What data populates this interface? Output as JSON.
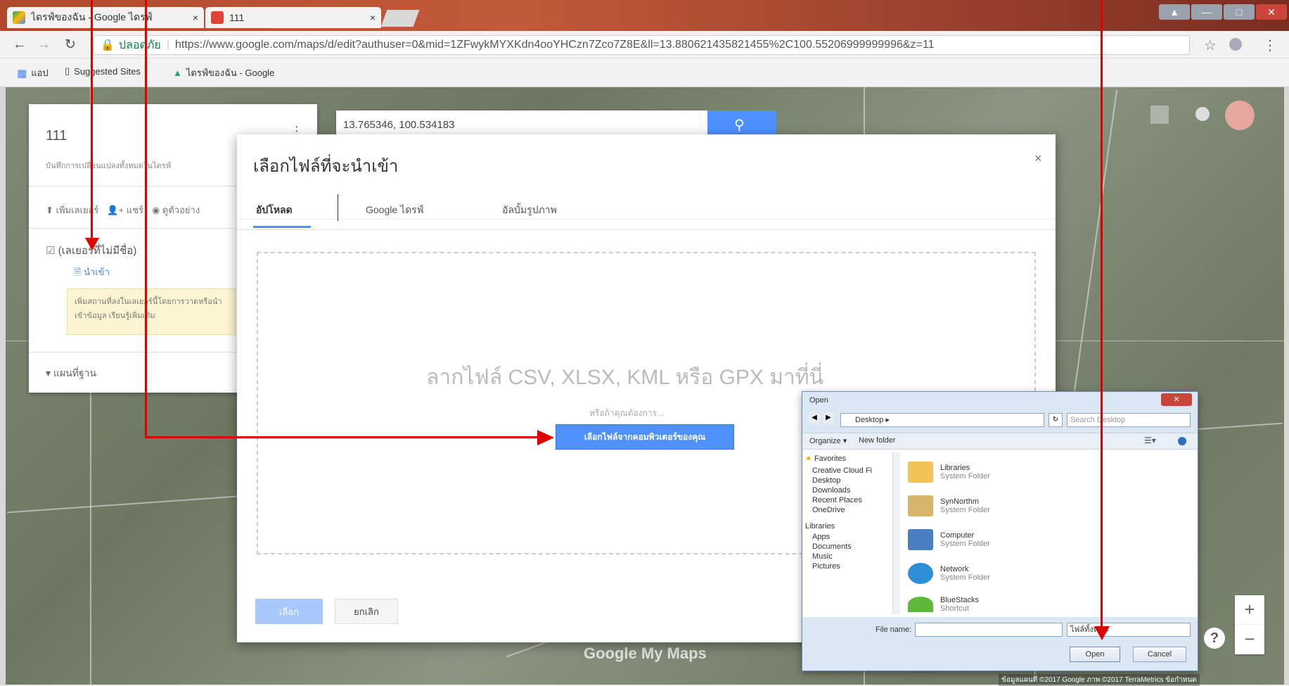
{
  "browser": {
    "tabs": [
      {
        "label": "ไดรฟ์ของฉัน - Google ไดรฟ์",
        "close": "×"
      },
      {
        "label": "111",
        "close": "×"
      }
    ],
    "url": "https://www.google.com/maps/d/edit?authuser=0&mid=1ZFwykMYXKdn4ooYHCzn7Zco7Z8E&ll=13.880621435821455%2C100.55206999999996&z=11",
    "secure_label": "ปลอดภัย",
    "bookmarks": [
      "แอป",
      "Suggested Sites",
      "ไดรฟ์ของฉัน - Google"
    ]
  },
  "panel": {
    "title": "111",
    "subtitle": "บันทึกการเปลี่ยนแปลงทั้งหมดในไดรฟ์",
    "actions": [
      "เพิ่มเลเยอร์",
      "แชร์",
      "ดูตัวอย่าง"
    ],
    "layer_name": "(เลเยอร์ที่ไม่มีชื่อ)",
    "import_link": "นำเข้า",
    "hint": "เพิ่มสถานที่ลงในเลเยอร์นี้โดยการวาดหรือนำเข้าข้อมูล เรียนรู้เพิ่มเติม",
    "basemap": "แผนที่ฐาน"
  },
  "search": {
    "value": "13.765346, 100.534183"
  },
  "dialog": {
    "title": "เลือกไฟล์ที่จะนำเข้า",
    "close": "×",
    "tabs": [
      "อัปโหลด",
      "Google ไดรฟ์",
      "อัลบั้มรูปภาพ"
    ],
    "drop_text": "ลากไฟล์ CSV, XLSX, KML หรือ GPX มาที่นี่",
    "or_text": "หรือถ้าคุณต้องการ...",
    "choose_button": "เลือกไฟล์จากคอมพิวเตอร์ของคุณ",
    "select_button": "เลือก",
    "cancel_button": "ยกเลิก"
  },
  "filedlg": {
    "title": "Open",
    "path": "Desktop ▸",
    "search_placeholder": "Search Desktop",
    "organize": "Organize ▾",
    "new_folder": "New folder",
    "nav": {
      "favorites": "Favorites",
      "items": [
        "Creative Cloud Fi",
        "Desktop",
        "Downloads",
        "Recent Places",
        "OneDrive"
      ],
      "libraries": "Libraries",
      "lib_items": [
        "Apps",
        "Documents",
        "Music",
        "Pictures"
      ]
    },
    "files": [
      {
        "name": "Libraries",
        "type": "System Folder"
      },
      {
        "name": "SynNorthm",
        "type": "System Folder"
      },
      {
        "name": "Computer",
        "type": "System Folder"
      },
      {
        "name": "Network",
        "type": "System Folder"
      },
      {
        "name": "BlueStacks",
        "type": "Shortcut"
      }
    ],
    "file_name_label": "File name:",
    "file_type": "ไฟล์ทั้งหมด",
    "open_button": "Open",
    "cancel_button": "Cancel"
  },
  "map": {
    "watermark": "Google My Maps",
    "attribution": "ข้อมูลแผนที่ ©2017 Google ภาพ ©2017 TerraMetrics  ข้อกำหนด"
  },
  "colors": {
    "accent": "#4d90fe",
    "arrow": "#e00000"
  }
}
